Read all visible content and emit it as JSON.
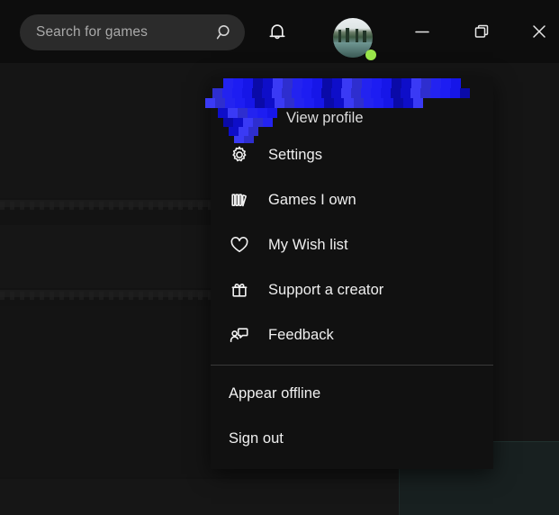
{
  "window": {
    "background_color": "#121212",
    "titlebar_color": "#0d0d0d"
  },
  "search": {
    "placeholder": "Search for games",
    "value": "",
    "icon": "search-icon"
  },
  "titlebar_actions": [
    {
      "name": "notifications-button",
      "icon": "bell-icon",
      "label": "Notifications"
    },
    {
      "name": "account-avatar-button",
      "icon": "avatar-icon",
      "label": "Account",
      "status": "online",
      "status_color": "#9ae64b"
    },
    {
      "name": "minimize-button",
      "icon": "minimize-icon",
      "label": "Minimize"
    },
    {
      "name": "maximize-button",
      "icon": "restore-icon",
      "label": "Restore"
    },
    {
      "name": "close-button",
      "icon": "close-icon",
      "label": "Close"
    }
  ],
  "account_menu": {
    "redacted_username": "",
    "redaction_color": "#1616e8",
    "items": [
      {
        "label": "View profile",
        "icon": "",
        "name": "menu-item-view-profile"
      },
      {
        "label": "Settings",
        "icon": "gear-icon",
        "name": "menu-item-settings"
      },
      {
        "label": "Games I own",
        "icon": "library-icon",
        "name": "menu-item-games-i-own"
      },
      {
        "label": "My Wish list",
        "icon": "heart-icon",
        "name": "menu-item-my-wish-list"
      },
      {
        "label": "Support a creator",
        "icon": "gift-icon",
        "name": "menu-item-support-a-creator"
      },
      {
        "label": "Feedback",
        "icon": "feedback-icon",
        "name": "menu-item-feedback"
      }
    ],
    "footer_items": [
      {
        "label": "Appear offline",
        "name": "menu-item-appear-offline"
      },
      {
        "label": "Sign out",
        "name": "menu-item-sign-out"
      }
    ]
  }
}
